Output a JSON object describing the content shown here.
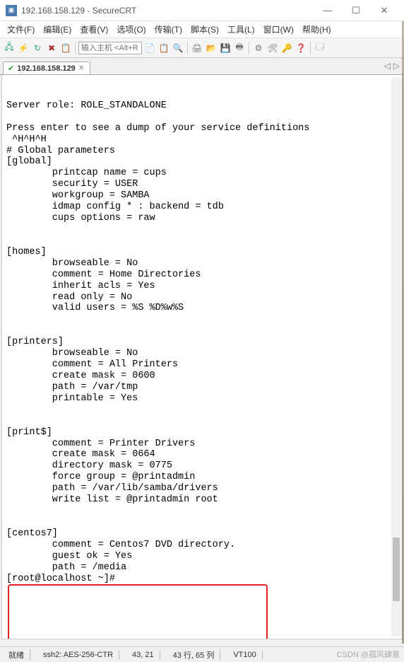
{
  "window": {
    "title": "192.168.158.129 - SecureCRT",
    "controls": {
      "minimize": "—",
      "maximize": "☐",
      "close": "✕"
    }
  },
  "menu": {
    "file": "文件(F)",
    "edit": "编辑(E)",
    "view": "查看(V)",
    "options": "选项(O)",
    "transfer": "传输(T)",
    "script": "脚本(S)",
    "tools": "工具(L)",
    "window": "窗口(W)",
    "help": "帮助(H)"
  },
  "toolbar": {
    "host_placeholder": "输入主机 <Alt+R"
  },
  "tab": {
    "title": "192.168.158.129",
    "close": "✕",
    "nav_left": "◁",
    "nav_right": "▷"
  },
  "terminal": {
    "lines": [
      "Server role: ROLE_STANDALONE",
      "",
      "Press enter to see a dump of your service definitions",
      " ^H^H^H",
      "# Global parameters",
      "[global]",
      "        printcap name = cups",
      "        security = USER",
      "        workgroup = SAMBA",
      "        idmap config * : backend = tdb",
      "        cups options = raw",
      "",
      "",
      "[homes]",
      "        browseable = No",
      "        comment = Home Directories",
      "        inherit acls = Yes",
      "        read only = No",
      "        valid users = %S %D%w%S",
      "",
      "",
      "[printers]",
      "        browseable = No",
      "        comment = All Printers",
      "        create mask = 0600",
      "        path = /var/tmp",
      "        printable = Yes",
      "",
      "",
      "[print$]",
      "        comment = Printer Drivers",
      "        create mask = 0664",
      "        directory mask = 0775",
      "        force group = @printadmin",
      "        path = /var/lib/samba/drivers",
      "        write list = @printadmin root",
      "",
      "",
      "[centos7]",
      "        comment = Centos7 DVD directory.",
      "        guest ok = Yes",
      "        path = /media",
      "[root@localhost ~]# "
    ]
  },
  "statusbar": {
    "ready": "就绪",
    "ssh": "ssh2: AES-256-CTR",
    "cursor": "43, 21",
    "rowscols": "43 行, 65 列",
    "term": "VT100"
  },
  "watermark": "CSDN @孤风肆意"
}
